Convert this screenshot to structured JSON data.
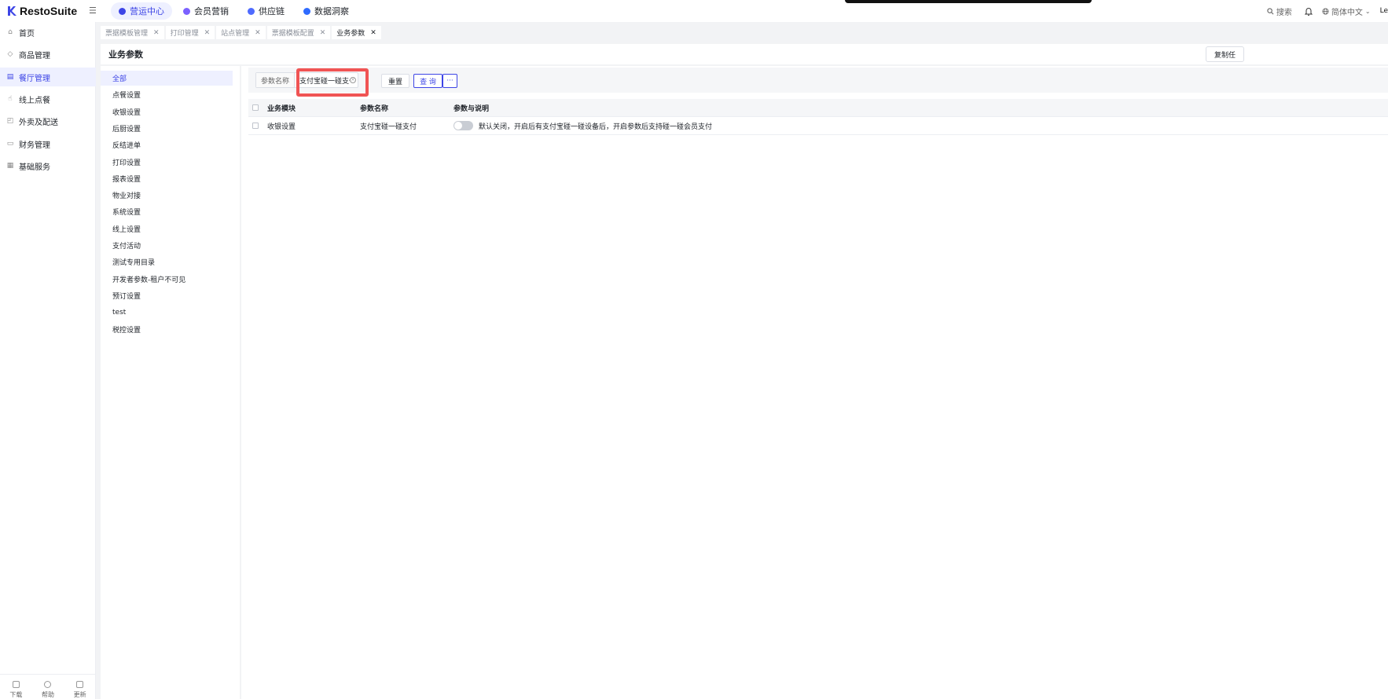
{
  "header": {
    "logo_text": "RestoSuite",
    "nav": [
      {
        "label": "营运中心",
        "color": "#3d45e6",
        "active": true
      },
      {
        "label": "会员营销",
        "color": "#7b61ff",
        "active": false
      },
      {
        "label": "供应链",
        "color": "#4f6bff",
        "active": false
      },
      {
        "label": "数据洞察",
        "color": "#2f6bff",
        "active": false
      }
    ],
    "search_label": "搜索",
    "language": "简体中文",
    "user_initial": "Le"
  },
  "sidebar": {
    "items": [
      {
        "label": "首页",
        "icon": "home-icon",
        "glyph": "⌂"
      },
      {
        "label": "商品管理",
        "icon": "box-icon",
        "glyph": "◇"
      },
      {
        "label": "餐厅管理",
        "icon": "store-icon",
        "glyph": "▤"
      },
      {
        "label": "线上点餐",
        "icon": "pointer-icon",
        "glyph": "☝"
      },
      {
        "label": "外卖及配送",
        "icon": "bag-icon",
        "glyph": "◰"
      },
      {
        "label": "财务管理",
        "icon": "wallet-icon",
        "glyph": "▭"
      },
      {
        "label": "基础服务",
        "icon": "grid-icon",
        "glyph": "▦"
      }
    ],
    "bottom": [
      {
        "label": "下载",
        "icon": "download-icon"
      },
      {
        "label": "帮助",
        "icon": "help-icon"
      },
      {
        "label": "更新",
        "icon": "update-icon"
      }
    ]
  },
  "tabs": [
    {
      "label": "票据模板管理"
    },
    {
      "label": "打印管理"
    },
    {
      "label": "站点管理"
    },
    {
      "label": "票据模板配置"
    },
    {
      "label": "业务参数"
    }
  ],
  "page": {
    "title": "业务参数",
    "copy_button": "复制任"
  },
  "categories": [
    "全部",
    "点餐设置",
    "收银设置",
    "后厨设置",
    "反结进单",
    "打印设置",
    "报表设置",
    "物业对接",
    "系统设置",
    "线上设置",
    "支付活动",
    "测试专用目录",
    "开发者参数-租户不可见",
    "预订设置",
    "test",
    "税控设置"
  ],
  "filter": {
    "label": "参数名称",
    "value": "支付宝碰一碰支付",
    "reset": "重置",
    "query": "查 询",
    "more": "···"
  },
  "table": {
    "headers": [
      "业务模块",
      "参数名称",
      "参数与说明"
    ],
    "rows": [
      {
        "module": "收银设置",
        "name": "支付宝碰一碰支付",
        "desc": "默认关闭，开启后有支付宝碰一碰设备后，开启参数后支持碰一碰会员支付",
        "enabled": false
      }
    ]
  }
}
